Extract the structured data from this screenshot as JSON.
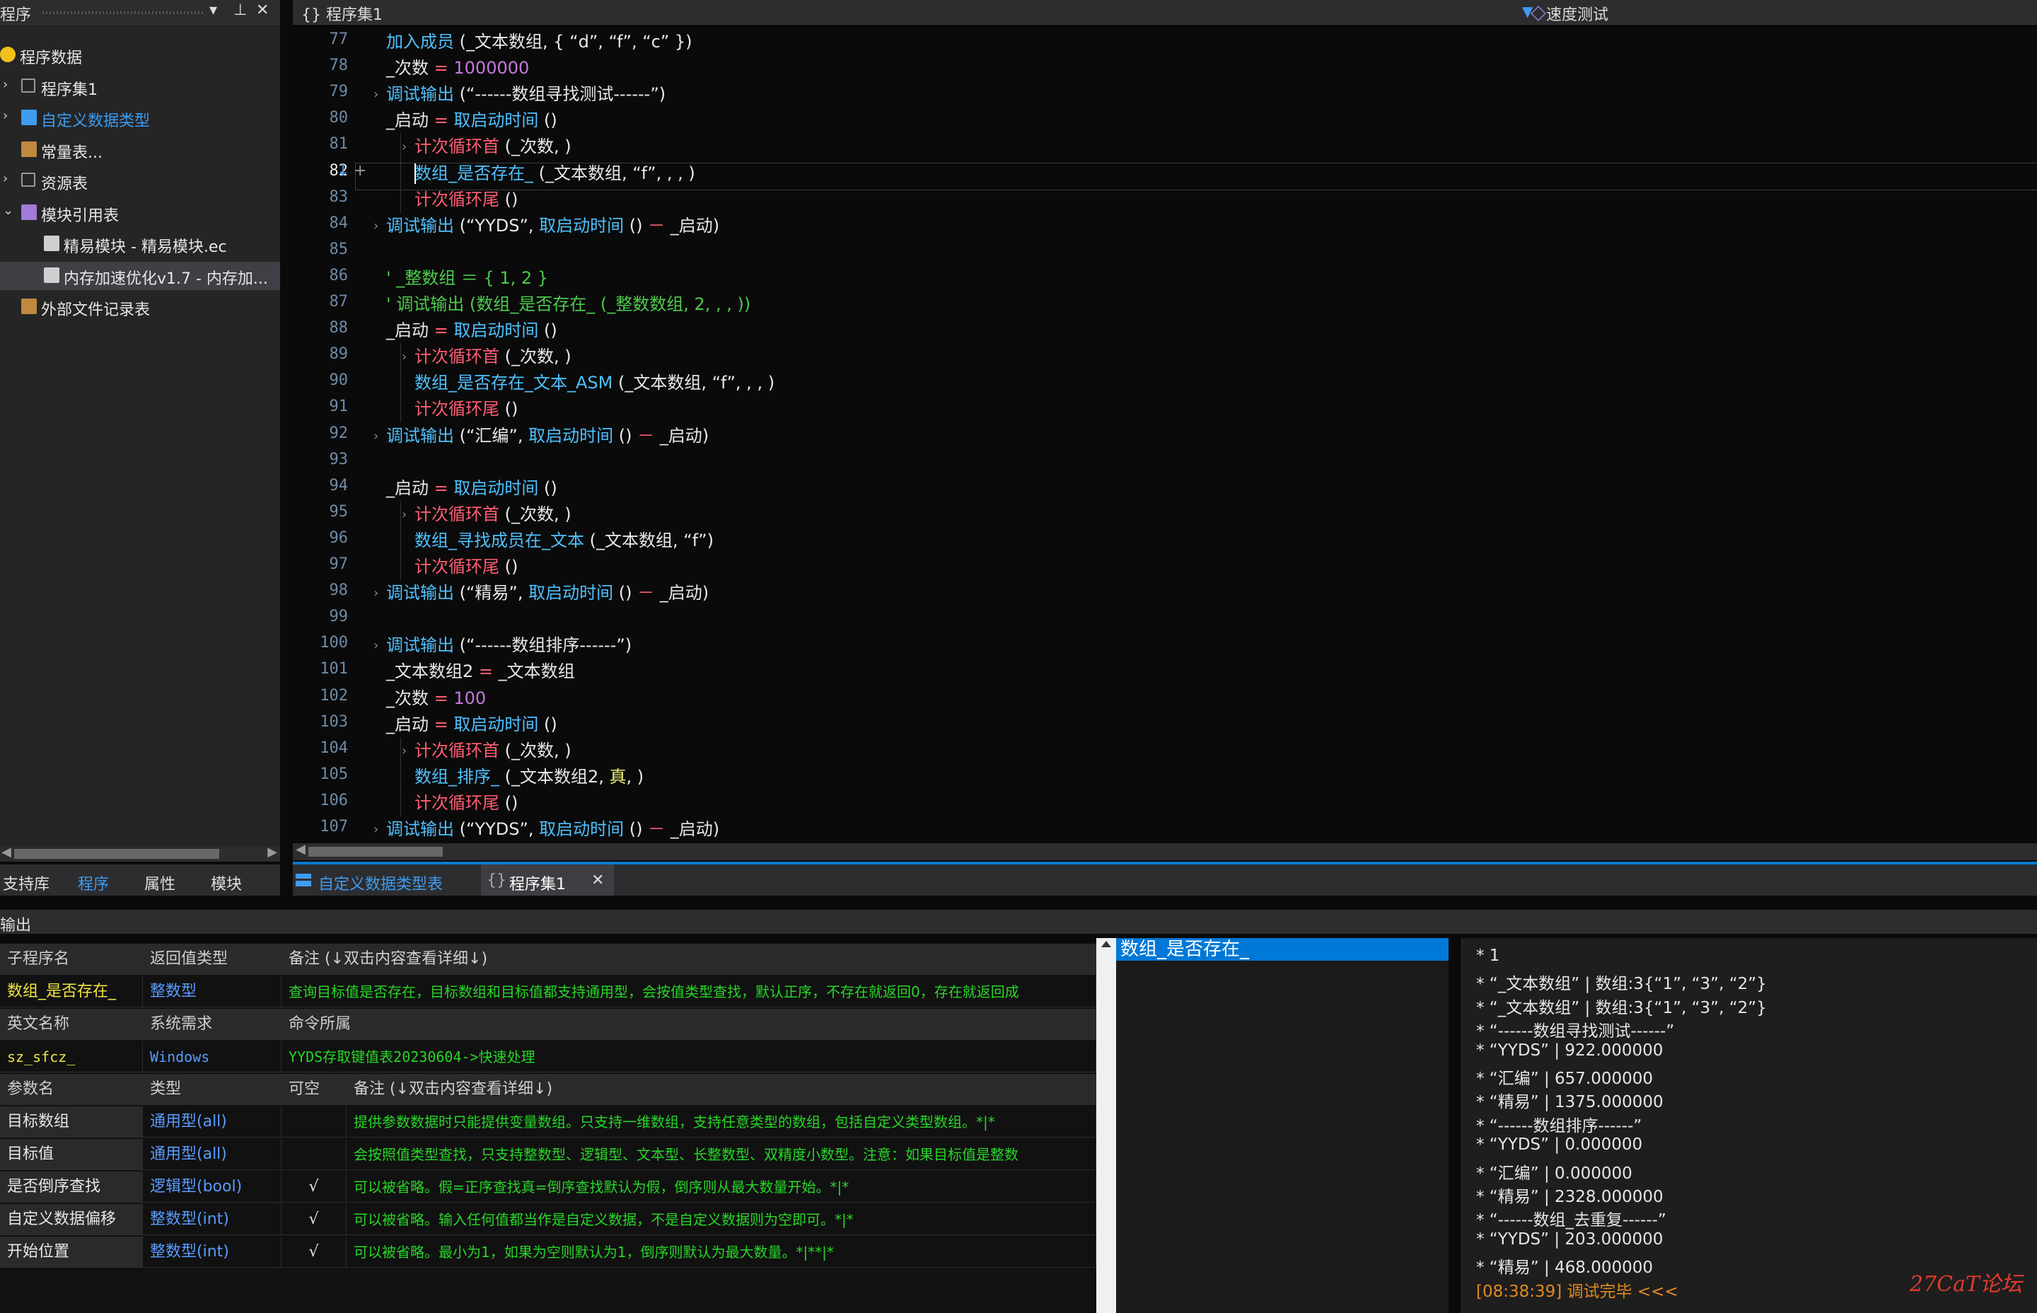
{
  "left_panel": {
    "title": "程序",
    "pin_icon": "pin-icon",
    "close_icon": "close-icon",
    "tree": [
      {
        "label": "程序数据",
        "icon": "smiley-icon",
        "chevron": ""
      },
      {
        "label": "程序集1",
        "icon": "braces-icon",
        "chevron": "›"
      },
      {
        "label": "自定义数据类型",
        "icon": "table-icon",
        "chevron": "›"
      },
      {
        "label": "常量表...",
        "icon": "constants-icon",
        "chevron": ""
      },
      {
        "label": "资源表",
        "icon": "resource-icon",
        "chevron": "›"
      },
      {
        "label": "模块引用表",
        "icon": "module-icon",
        "chevron": "⌄"
      },
      {
        "label": "精易模块 - 精易模块.ec",
        "icon": "module-file-icon",
        "chevron": ""
      },
      {
        "label": "内存加速优化v1.7 - 内存加...",
        "icon": "module-file-icon",
        "chevron": ""
      },
      {
        "label": "外部文件记录表",
        "icon": "file-record-icon",
        "chevron": ""
      }
    ],
    "tabs": [
      "支持库",
      "程序",
      "属性",
      "模块"
    ],
    "active_tab": "程序"
  },
  "editor_header": {
    "left": "{} 程序集1",
    "right": "速度测试"
  },
  "editor": {
    "current_line": 82,
    "lines": [
      {
        "n": "77",
        "indent": 1,
        "fold": "",
        "segs": [
          [
            "加入成员",
            "cyan"
          ],
          [
            " (_文本数组, { “d”, “f”, “c” })",
            "white"
          ]
        ]
      },
      {
        "n": "78",
        "indent": 1,
        "fold": "",
        "segs": [
          [
            "_次数 ",
            "white"
          ],
          [
            "=",
            "pink"
          ],
          [
            " 1000000",
            "purple"
          ]
        ]
      },
      {
        "n": "79",
        "indent": 1,
        "fold": "›",
        "segs": [
          [
            "调试输出",
            "cyan"
          ],
          [
            " (“------数组寻找测试------”)",
            "white"
          ]
        ]
      },
      {
        "n": "80",
        "indent": 1,
        "fold": "",
        "segs": [
          [
            "_启动 ",
            "white"
          ],
          [
            "=",
            "pink"
          ],
          [
            " 取启动时间",
            "cyan"
          ],
          [
            " ()",
            "white"
          ]
        ]
      },
      {
        "n": "81",
        "indent": 2,
        "fold": "›",
        "segs": [
          [
            "计次循环首",
            "pink"
          ],
          [
            " (_次数, )",
            "white"
          ]
        ]
      },
      {
        "n": "82",
        "indent": 2,
        "fold": "",
        "segs": [
          [
            "数组_是否存在_",
            "cyan"
          ],
          [
            " (_文本数组, “f”, , , )",
            "white"
          ]
        ]
      },
      {
        "n": "83",
        "indent": 2,
        "fold": "",
        "segs": [
          [
            "计次循环尾",
            "pink"
          ],
          [
            " ()",
            "white"
          ]
        ]
      },
      {
        "n": "84",
        "indent": 1,
        "fold": "›",
        "segs": [
          [
            "调试输出",
            "cyan"
          ],
          [
            " (“YYDS”, ",
            "white"
          ],
          [
            "取启动时间",
            "cyan"
          ],
          [
            " () ",
            "white"
          ],
          [
            "－",
            "pink"
          ],
          [
            " _启动)",
            "white"
          ]
        ]
      },
      {
        "n": "85",
        "indent": 1,
        "fold": "",
        "segs": []
      },
      {
        "n": "86",
        "indent": 1,
        "fold": "",
        "segs": [
          [
            "' _整数组 ＝ { 1, 2 }",
            "green"
          ]
        ]
      },
      {
        "n": "87",
        "indent": 1,
        "fold": "",
        "segs": [
          [
            "' 调试输出 (数组_是否存在_ (_整数数组, 2, , , ))",
            "green"
          ]
        ]
      },
      {
        "n": "88",
        "indent": 1,
        "fold": "",
        "segs": [
          [
            "_启动 ",
            "white"
          ],
          [
            "=",
            "pink"
          ],
          [
            " 取启动时间",
            "cyan"
          ],
          [
            " ()",
            "white"
          ]
        ]
      },
      {
        "n": "89",
        "indent": 2,
        "fold": "›",
        "segs": [
          [
            "计次循环首",
            "pink"
          ],
          [
            " (_次数, )",
            "white"
          ]
        ]
      },
      {
        "n": "90",
        "indent": 2,
        "fold": "",
        "segs": [
          [
            "数组_是否存在_文本_ASM",
            "cyan"
          ],
          [
            " (_文本数组, “f”, , , )",
            "white"
          ]
        ]
      },
      {
        "n": "91",
        "indent": 2,
        "fold": "",
        "segs": [
          [
            "计次循环尾",
            "pink"
          ],
          [
            " ()",
            "white"
          ]
        ]
      },
      {
        "n": "92",
        "indent": 1,
        "fold": "›",
        "segs": [
          [
            "调试输出",
            "cyan"
          ],
          [
            " (“汇编”, ",
            "white"
          ],
          [
            "取启动时间",
            "cyan"
          ],
          [
            " () ",
            "white"
          ],
          [
            "－",
            "pink"
          ],
          [
            " _启动)",
            "white"
          ]
        ]
      },
      {
        "n": "93",
        "indent": 1,
        "fold": "",
        "segs": []
      },
      {
        "n": "94",
        "indent": 1,
        "fold": "",
        "segs": [
          [
            "_启动 ",
            "white"
          ],
          [
            "=",
            "pink"
          ],
          [
            " 取启动时间",
            "cyan"
          ],
          [
            " ()",
            "white"
          ]
        ]
      },
      {
        "n": "95",
        "indent": 2,
        "fold": "›",
        "segs": [
          [
            "计次循环首",
            "pink"
          ],
          [
            " (_次数, )",
            "white"
          ]
        ]
      },
      {
        "n": "96",
        "indent": 2,
        "fold": "",
        "segs": [
          [
            "数组_寻找成员在_文本",
            "cyan"
          ],
          [
            " (_文本数组, “f”)",
            "white"
          ]
        ]
      },
      {
        "n": "97",
        "indent": 2,
        "fold": "",
        "segs": [
          [
            "计次循环尾",
            "pink"
          ],
          [
            " ()",
            "white"
          ]
        ]
      },
      {
        "n": "98",
        "indent": 1,
        "fold": "›",
        "segs": [
          [
            "调试输出",
            "cyan"
          ],
          [
            " (“精易”, ",
            "white"
          ],
          [
            "取启动时间",
            "cyan"
          ],
          [
            " () ",
            "white"
          ],
          [
            "－",
            "pink"
          ],
          [
            " _启动)",
            "white"
          ]
        ]
      },
      {
        "n": "99",
        "indent": 1,
        "fold": "",
        "segs": []
      },
      {
        "n": "100",
        "indent": 1,
        "fold": "›",
        "segs": [
          [
            "调试输出",
            "cyan"
          ],
          [
            " (“------数组排序------”)",
            "white"
          ]
        ]
      },
      {
        "n": "101",
        "indent": 1,
        "fold": "",
        "segs": [
          [
            "_文本数组2 ",
            "white"
          ],
          [
            "=",
            "pink"
          ],
          [
            " _文本数组",
            "white"
          ]
        ]
      },
      {
        "n": "102",
        "indent": 1,
        "fold": "",
        "segs": [
          [
            "_次数 ",
            "white"
          ],
          [
            "=",
            "pink"
          ],
          [
            " 100",
            "purple"
          ]
        ]
      },
      {
        "n": "103",
        "indent": 1,
        "fold": "",
        "segs": [
          [
            "_启动 ",
            "white"
          ],
          [
            "=",
            "pink"
          ],
          [
            " 取启动时间",
            "cyan"
          ],
          [
            " ()",
            "white"
          ]
        ]
      },
      {
        "n": "104",
        "indent": 2,
        "fold": "›",
        "segs": [
          [
            "计次循环首",
            "pink"
          ],
          [
            " (_次数, )",
            "white"
          ]
        ]
      },
      {
        "n": "105",
        "indent": 2,
        "fold": "",
        "segs": [
          [
            "数组_排序_",
            "cyan"
          ],
          [
            " (_文本数组2, ",
            "white"
          ],
          [
            "真",
            "yellow"
          ],
          [
            ", )",
            "white"
          ]
        ]
      },
      {
        "n": "106",
        "indent": 2,
        "fold": "",
        "segs": [
          [
            "计次循环尾",
            "pink"
          ],
          [
            " ()",
            "white"
          ]
        ]
      },
      {
        "n": "107",
        "indent": 1,
        "fold": "›",
        "segs": [
          [
            "调试输出",
            "cyan"
          ],
          [
            " (“YYDS”, ",
            "white"
          ],
          [
            "取启动时间",
            "cyan"
          ],
          [
            " () ",
            "white"
          ],
          [
            "－",
            "pink"
          ],
          [
            " _启动)",
            "white"
          ]
        ]
      }
    ]
  },
  "editor_tabs": [
    {
      "label": "自定义数据类型表",
      "icon": "table-icon",
      "active": false
    },
    {
      "label": "程序集1",
      "icon": "braces-icon",
      "active": true,
      "closable": true
    }
  ],
  "output": {
    "title": "输出",
    "table": {
      "header1": [
        "子程序名",
        "返回值类型",
        "备注 (↓双击内容查看详细↓)"
      ],
      "row1": [
        "数组_是否存在_",
        "整数型",
        "查询目标值是否存在，目标数组和目标值都支持通用型，会按值类型查找，默认正序，不存在就返回0，存在就返回成"
      ],
      "header2": [
        "英文名称",
        "系统需求",
        "命令所属"
      ],
      "row2": [
        "sz_sfcz_",
        "Windows",
        "YYDS存取键值表20230604->快速处理"
      ],
      "header3": [
        "参数名",
        "类型",
        "可空",
        "备注 (↓双击内容查看详细↓)"
      ],
      "params": [
        {
          "name": "目标数组",
          "type": "通用型(all)",
          "nullable": "",
          "note": "提供参数数据时只能提供变量数组。只支持一维数组，支持任意类型的数组，包括自定义类型数组。*|*"
        },
        {
          "name": "目标值",
          "type": "通用型(all)",
          "nullable": "",
          "note": "会按照值类型查找，只支持整数型、逻辑型、文本型、长整数型、双精度小数型。注意：如果目标值是整数"
        },
        {
          "name": "是否倒序查找",
          "type": "逻辑型(bool)",
          "nullable": "√",
          "note": "可以被省略。假=正序查找真=倒序查找默认为假，倒序则从最大数量开始。*|*"
        },
        {
          "name": "自定义数据偏移",
          "type": "整数型(int)",
          "nullable": "√",
          "note": "可以被省略。输入任何值都当作是自定义数据，不是自定义数据则为空即可。*|*"
        },
        {
          "name": "开始位置",
          "type": "整数型(int)",
          "nullable": "√",
          "note": "可以被省略。最小为1，如果为空则默认为1，倒序则默认为最大数量。*|**|*"
        }
      ]
    },
    "suggest": "数组_是否存在_",
    "debug_lines": [
      "* 1",
      "* “_文本数组” | 数组:3{“1”, “3”, “2”}",
      "* “_文本数组” | 数组:3{“1”, “3”, “2”}",
      "* “------数组寻找测试------”",
      "* “YYDS” | 922.000000",
      "* “汇编” | 657.000000",
      "* “精易” | 1375.000000",
      "* “------数组排序------”",
      "* “YYDS” | 0.000000",
      "* “汇编” | 0.000000",
      "* “精易” | 2328.000000",
      "* “------数组_去重复------”",
      "* “YYDS” | 203.000000",
      "* “精易” | 468.000000",
      "[08:38:39] 调试完毕 <<<"
    ],
    "watermark": "27CaT论坛"
  },
  "colors": {
    "cyan": "#4fc1ff",
    "pink": "#ff5d73",
    "green": "#4ec94e",
    "white": "#e8e8e8",
    "purple": "#c678dd",
    "yellow": "#f0f07a",
    "accent": "#007acc"
  }
}
